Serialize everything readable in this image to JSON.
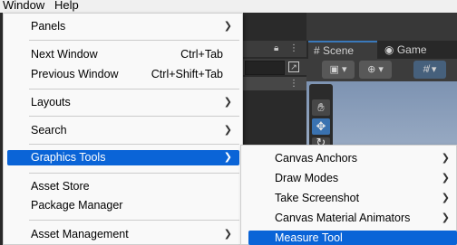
{
  "menubar": {
    "items": [
      "Window",
      "Help"
    ]
  },
  "editor": {
    "tabs": [
      {
        "label": "Scene",
        "icon": "hash-icon",
        "active": true
      },
      {
        "label": "Game",
        "icon": "gamepad-icon",
        "active": false
      }
    ]
  },
  "window_menu": {
    "items": [
      {
        "label": "Panels",
        "shortcut": "",
        "submenu": true
      },
      {
        "label": "Next Window",
        "shortcut": "Ctrl+Tab",
        "submenu": false
      },
      {
        "label": "Previous Window",
        "shortcut": "Ctrl+Shift+Tab",
        "submenu": false
      },
      {
        "label": "Layouts",
        "shortcut": "",
        "submenu": true
      },
      {
        "label": "Search",
        "shortcut": "",
        "submenu": true
      },
      {
        "label": "Graphics Tools",
        "shortcut": "",
        "submenu": true,
        "highlighted": true
      },
      {
        "label": "Asset Store",
        "shortcut": "",
        "submenu": false
      },
      {
        "label": "Package Manager",
        "shortcut": "",
        "submenu": false
      },
      {
        "label": "Asset Management",
        "shortcut": "",
        "submenu": true
      }
    ]
  },
  "graphics_tools_submenu": {
    "items": [
      {
        "label": "Canvas Anchors",
        "submenu": true
      },
      {
        "label": "Draw Modes",
        "submenu": true
      },
      {
        "label": "Take Screenshot",
        "submenu": true
      },
      {
        "label": "Canvas Material Animators",
        "submenu": true
      },
      {
        "label": "Measure Tool",
        "submenu": false,
        "highlighted": true
      }
    ]
  },
  "colors": {
    "highlight": "#0a64d7",
    "menu_bg": "#f9f9f9",
    "editor_dark": "#383838"
  }
}
